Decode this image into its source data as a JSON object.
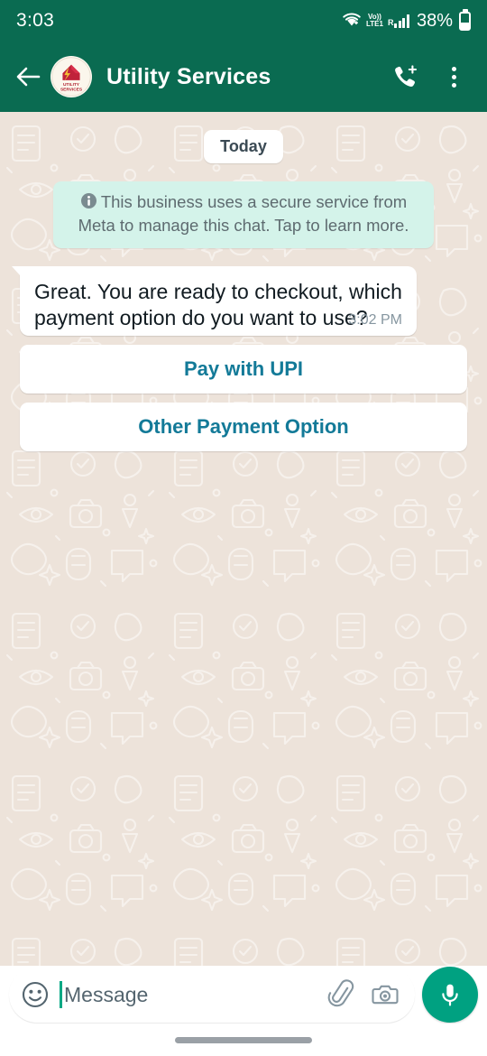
{
  "status_bar": {
    "time": "3:03",
    "wifi_icon": "wifi-icon",
    "volte_top": "Vo))",
    "volte_bottom": "LTE1",
    "roaming_label": "R",
    "signal_icon": "signal-bars-icon",
    "battery_percent": "38%",
    "battery_icon": "battery-icon",
    "battery_level": 38
  },
  "app_bar": {
    "back_icon": "back-arrow-icon",
    "avatar_name": "contact-avatar",
    "avatar_logo_text_line1": "UTILITY",
    "avatar_logo_text_line2": "SERVICES",
    "title": "Utility Services",
    "video_call_icon": "add-call-icon",
    "menu_icon": "overflow-menu-icon"
  },
  "chat": {
    "day_divider": "Today",
    "business_notice": {
      "icon": "info-icon",
      "text": "This business uses a secure service from Meta to manage this chat. Tap to learn more."
    },
    "messages": [
      {
        "sender": "business",
        "text": "Great. You are ready to checkout, which payment option do you want to use?",
        "time": "3:02 PM"
      }
    ],
    "reply_buttons": [
      {
        "label": "Pay with UPI"
      },
      {
        "label": "Other Payment Option"
      }
    ]
  },
  "input_bar": {
    "emoji_icon": "emoji-smiley-icon",
    "placeholder": "Message",
    "attach_icon": "paperclip-icon",
    "camera_icon": "camera-icon",
    "mic_icon": "microphone-icon"
  },
  "nav_bar": {
    "handle": "gesture-home-handle"
  },
  "colors": {
    "header_green": "#0A6B51",
    "chat_background": "#EDE3DA",
    "bubble_white": "#FFFFFF",
    "notice_mint": "#D4F3EA",
    "link_teal": "#137A98",
    "mic_green": "#00A181",
    "cursor_green": "#00A884"
  }
}
